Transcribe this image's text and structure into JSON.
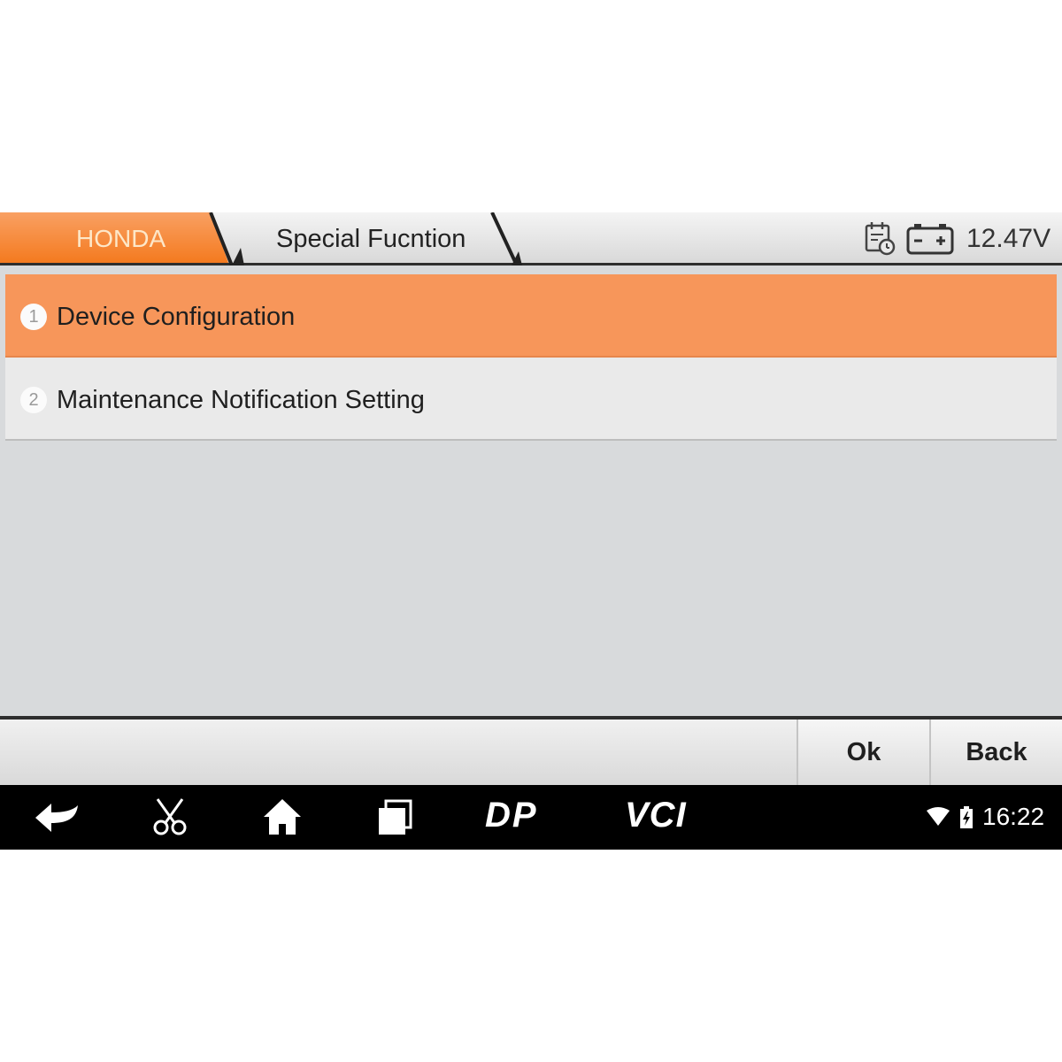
{
  "header": {
    "breadcrumb": [
      "HONDA",
      "Special Fucntion"
    ],
    "voltage": "12.47V",
    "icons": [
      "calendar-clock-icon",
      "battery-icon"
    ],
    "colors": {
      "accent": "#f47a1f",
      "accent_light": "#f9a063"
    }
  },
  "menu": {
    "items": [
      {
        "number": "1",
        "label": "Device Configuration",
        "selected": true
      },
      {
        "number": "2",
        "label": "Maintenance Notification Setting",
        "selected": false
      }
    ],
    "colors": {
      "selected": "#f7965a",
      "normal": "#eaeaea"
    }
  },
  "buttons": {
    "ok": "Ok",
    "back": "Back"
  },
  "navbar": {
    "icons": [
      "back-icon",
      "scissors-icon",
      "home-icon",
      "recent-apps-icon"
    ],
    "dp_label": "DP",
    "vci_label": "VCI",
    "status_icons": [
      "wifi-icon",
      "battery-charging-icon"
    ],
    "time": "16:22"
  }
}
